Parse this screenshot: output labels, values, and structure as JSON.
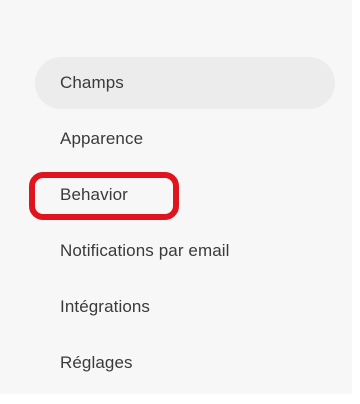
{
  "sidebar": {
    "items": [
      {
        "label": "Champs",
        "active": true
      },
      {
        "label": "Apparence",
        "active": false
      },
      {
        "label": "Behavior",
        "active": false,
        "highlighted": true
      },
      {
        "label": "Notifications par email",
        "active": false
      },
      {
        "label": "Intégrations",
        "active": false
      },
      {
        "label": "Réglages",
        "active": false
      }
    ]
  },
  "colors": {
    "active_background": "#ececec",
    "highlight_outline": "#e0141f",
    "panel_background": "#f7f7f7",
    "text": "#3a3a3a"
  }
}
